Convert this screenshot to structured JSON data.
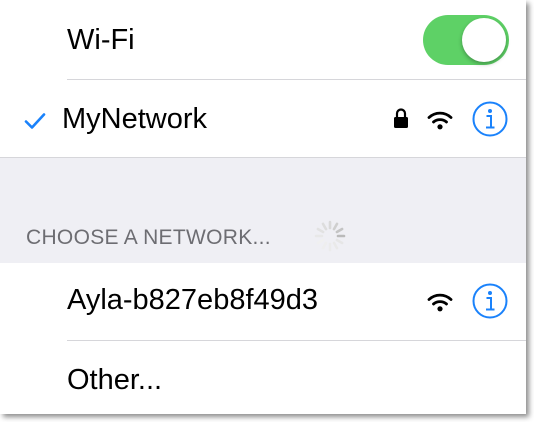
{
  "wifi_row": {
    "label": "Wi-Fi",
    "toggle_on": true,
    "toggle_color": "#5ed166"
  },
  "connected_network": {
    "name": "MyNetwork",
    "checkmark_icon": "checkmark-icon",
    "secured": true,
    "lock_icon": "lock-icon",
    "signal_icon": "wifi-signal-icon",
    "info_icon": "info-icon"
  },
  "choose_section": {
    "header": "CHOOSE A NETWORK...",
    "loading_icon": "spinner-icon"
  },
  "networks": [
    {
      "name": "Ayla-b827eb8f49d3",
      "secured": false,
      "signal_icon": "wifi-signal-icon",
      "info_icon": "info-icon"
    }
  ],
  "other_row": {
    "label": "Other..."
  },
  "colors": {
    "accent": "#1a82fb",
    "toggle_on": "#5ed166",
    "group_background": "#efeff4",
    "section_header_text": "#6d6d72",
    "separator": "#d6d6da"
  }
}
